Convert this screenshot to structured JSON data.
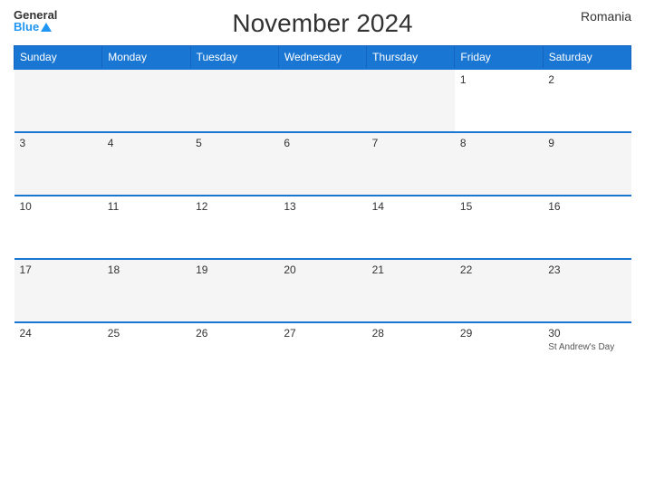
{
  "header": {
    "title": "November 2024",
    "country": "Romania",
    "logo_general": "General",
    "logo_blue": "Blue"
  },
  "days_of_week": [
    "Sunday",
    "Monday",
    "Tuesday",
    "Wednesday",
    "Thursday",
    "Friday",
    "Saturday"
  ],
  "weeks": [
    [
      {
        "day": "",
        "empty": true
      },
      {
        "day": "",
        "empty": true
      },
      {
        "day": "",
        "empty": true
      },
      {
        "day": "",
        "empty": true
      },
      {
        "day": "",
        "empty": true
      },
      {
        "day": "1",
        "empty": false
      },
      {
        "day": "2",
        "empty": false
      }
    ],
    [
      {
        "day": "3",
        "empty": false
      },
      {
        "day": "4",
        "empty": false
      },
      {
        "day": "5",
        "empty": false
      },
      {
        "day": "6",
        "empty": false
      },
      {
        "day": "7",
        "empty": false
      },
      {
        "day": "8",
        "empty": false
      },
      {
        "day": "9",
        "empty": false
      }
    ],
    [
      {
        "day": "10",
        "empty": false
      },
      {
        "day": "11",
        "empty": false
      },
      {
        "day": "12",
        "empty": false
      },
      {
        "day": "13",
        "empty": false
      },
      {
        "day": "14",
        "empty": false
      },
      {
        "day": "15",
        "empty": false
      },
      {
        "day": "16",
        "empty": false
      }
    ],
    [
      {
        "day": "17",
        "empty": false
      },
      {
        "day": "18",
        "empty": false
      },
      {
        "day": "19",
        "empty": false
      },
      {
        "day": "20",
        "empty": false
      },
      {
        "day": "21",
        "empty": false
      },
      {
        "day": "22",
        "empty": false
      },
      {
        "day": "23",
        "empty": false
      }
    ],
    [
      {
        "day": "24",
        "empty": false
      },
      {
        "day": "25",
        "empty": false
      },
      {
        "day": "26",
        "empty": false
      },
      {
        "day": "27",
        "empty": false
      },
      {
        "day": "28",
        "empty": false
      },
      {
        "day": "29",
        "empty": false
      },
      {
        "day": "30",
        "empty": false,
        "holiday": "St Andrew's Day"
      }
    ]
  ]
}
